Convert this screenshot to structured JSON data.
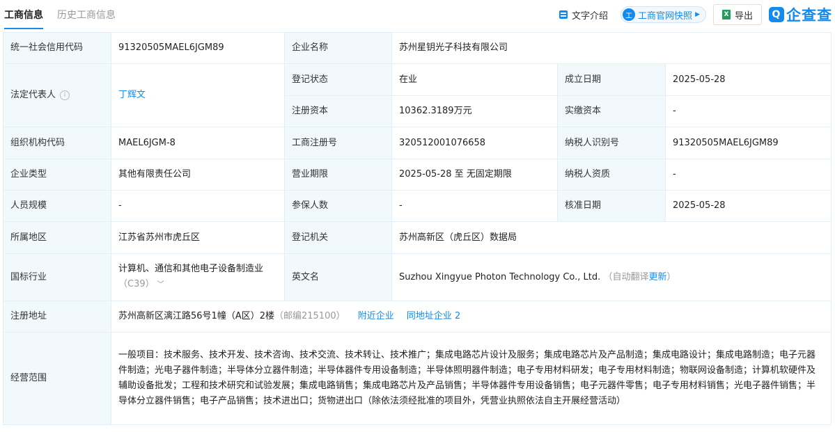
{
  "tabs": {
    "active": "工商信息",
    "history": "历史工商信息"
  },
  "toolbar": {
    "text_intro": "文字介绍",
    "snapshot": "工商官网快照",
    "export": "导出",
    "logo": "企查查",
    "xls_glyph": "X",
    "logo_glyph": "Q",
    "snapshot_glyph": "工"
  },
  "fields": {
    "credit_code_label": "统一社会信用代码",
    "credit_code": "91320505MAEL6JGM89",
    "company_name_label": "企业名称",
    "company_name": "苏州星钥光子科技有限公司",
    "legal_rep_label": "法定代表人",
    "legal_rep": "丁辉文",
    "reg_status_label": "登记状态",
    "reg_status": "在业",
    "found_date_label": "成立日期",
    "found_date": "2025-05-28",
    "reg_capital_label": "注册资本",
    "reg_capital": "10362.3189万元",
    "paid_capital_label": "实缴资本",
    "paid_capital": "-",
    "org_code_label": "组织机构代码",
    "org_code": "MAEL6JGM-8",
    "reg_no_label": "工商注册号",
    "reg_no": "320512001076658",
    "taxpayer_id_label": "纳税人识别号",
    "taxpayer_id": "91320505MAEL6JGM89",
    "company_type_label": "企业类型",
    "company_type": "其他有限责任公司",
    "biz_term_label": "营业期限",
    "biz_term": "2025-05-28 至 无固定期限",
    "taxpayer_qual_label": "纳税人资质",
    "taxpayer_qual": "-",
    "staff_size_label": "人员规模",
    "staff_size": "-",
    "insured_label": "参保人数",
    "insured": "-",
    "approval_date_label": "核准日期",
    "approval_date": "2025-05-28",
    "region_label": "所属地区",
    "region": "江苏省苏州市虎丘区",
    "reg_authority_label": "登记机关",
    "reg_authority": "苏州高新区（虎丘区）数据局",
    "industry_label": "国标行业",
    "industry": "计算机、通信和其他电子设备制造业",
    "industry_code": "（C39）",
    "english_name_label": "英文名",
    "english_name": "Suzhou Xingyue Photon Technology Co., Ltd.",
    "auto_translate": "（自动翻译",
    "update": "更新",
    "close_paren": "）",
    "address_label": "注册地址",
    "address": "苏州高新区漓江路56号1幢（A区）2楼",
    "postcode": "（邮编215100）",
    "nearby": "附近企业",
    "same_address": "同地址企业 2",
    "scope_label": "经营范围",
    "scope": "一般项目：技术服务、技术开发、技术咨询、技术交流、技术转让、技术推广；集成电路芯片设计及服务；集成电路芯片及产品制造；集成电路设计；集成电路制造；电子元器件制造；光电子器件制造；半导体分立器件制造；半导体器件专用设备制造；半导体照明器件制造；电子专用材料研发；电子专用材料制造；物联网设备制造；计算机软硬件及辅助设备批发；工程和技术研究和试验发展；集成电路销售；集成电路芯片及产品销售；半导体器件专用设备销售；电子元器件零售；电子专用材料销售；光电子器件销售；半导体分立器件销售；电子产品销售；技术进出口；货物进出口（除依法须经批准的项目外，凭营业执照依法自主开展经营活动）"
  }
}
